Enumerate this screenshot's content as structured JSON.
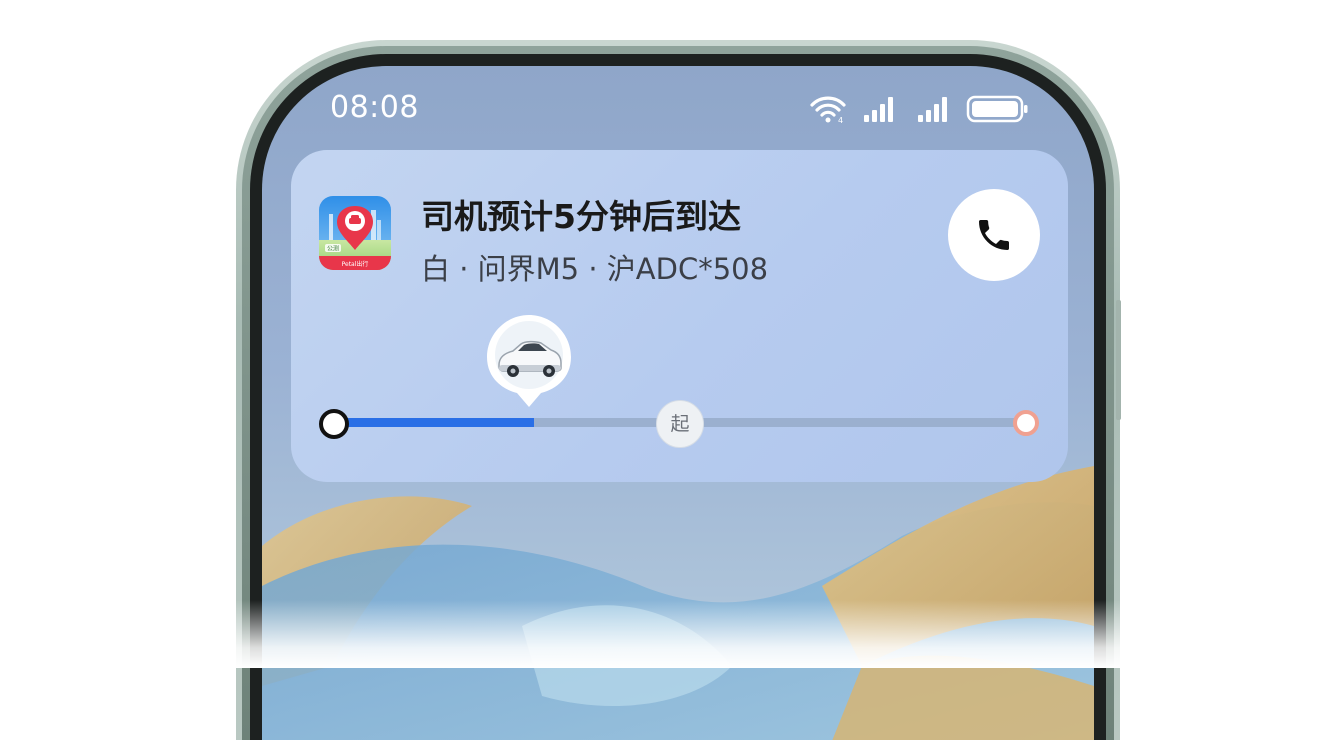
{
  "status_bar": {
    "time": "08:08",
    "icons": [
      "wifi-icon",
      "signal-bars-icon",
      "signal-bars-icon",
      "battery-icon"
    ]
  },
  "notification": {
    "app_icon_label": "Petal出行",
    "app_icon_badge": "公测",
    "title": "司机预计5分钟后到达",
    "subtitle": "白 · 问界M5 · 沪ADC*508",
    "call_icon": "phone-icon",
    "car_icon": "car-icon",
    "progress": {
      "car_progress": 0.29,
      "pickup_position": 0.5,
      "pickup_label": "起"
    }
  },
  "colors": {
    "accent": "#2a6fe6",
    "card_background": "#bcd0f0",
    "end_marker": "#f0a191"
  }
}
